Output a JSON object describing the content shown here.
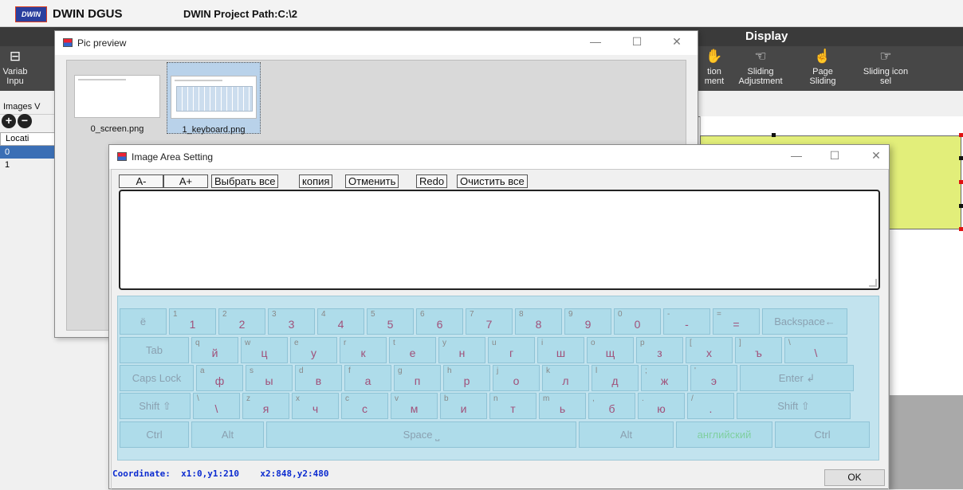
{
  "app": {
    "name": "DWIN DGUS",
    "logo_text": "DWIN",
    "path": "DWIN Project Path:C:\\2"
  },
  "ribbon": {
    "display_tab": "Display",
    "left_item": {
      "label1": "Variab",
      "label2": "Inpu"
    },
    "items": [
      {
        "label1": "tion",
        "label2": "ment"
      },
      {
        "label1": "Sliding",
        "label2": "Adjustment"
      },
      {
        "label1": "Page",
        "label2": "Sliding"
      },
      {
        "label1": "Sliding icon",
        "label2": "sel"
      }
    ]
  },
  "left_panel": {
    "tab_label": "Images V",
    "add_icon": "+",
    "remove_icon": "−",
    "column_header": "Locati",
    "rows": [
      "0",
      "1"
    ]
  },
  "pic_preview": {
    "title": "Pic preview",
    "min": "—",
    "max": "☐",
    "close": "✕",
    "thumbs": [
      {
        "caption": "0_screen.png"
      },
      {
        "caption": "1_keyboard.png"
      }
    ]
  },
  "area_setting": {
    "title": "Image Area Setting",
    "min": "—",
    "max": "☐",
    "close": "✕",
    "toolbar": {
      "a_minus": "A-",
      "a_plus": "A+",
      "select_all": "Выбрать все",
      "copy": "копия",
      "undo": "Отменить",
      "redo": "Redo",
      "clear_all": "Очистить все"
    },
    "text_value": "",
    "coordinate": "Coordinate:  x1:0,y1:210    x2:848,y2:480",
    "ok_label": "OK"
  },
  "keyboard": {
    "row1": [
      {
        "s": "",
        "p": "ё"
      },
      {
        "s": "1",
        "p": "1"
      },
      {
        "s": "2",
        "p": "2"
      },
      {
        "s": "3",
        "p": "3"
      },
      {
        "s": "4",
        "p": "4"
      },
      {
        "s": "5",
        "p": "5"
      },
      {
        "s": "6",
        "p": "6"
      },
      {
        "s": "7",
        "p": "7"
      },
      {
        "s": "8",
        "p": "8"
      },
      {
        "s": "9",
        "p": "9"
      },
      {
        "s": "0",
        "p": "0"
      },
      {
        "s": "-",
        "p": "-"
      },
      {
        "s": "=",
        "p": "="
      },
      {
        "s": "",
        "p": "Backspace←"
      }
    ],
    "row2": [
      {
        "s": "",
        "p": "Tab"
      },
      {
        "s": "q",
        "p": "й"
      },
      {
        "s": "w",
        "p": "ц"
      },
      {
        "s": "e",
        "p": "у"
      },
      {
        "s": "r",
        "p": "к"
      },
      {
        "s": "t",
        "p": "е"
      },
      {
        "s": "y",
        "p": "н"
      },
      {
        "s": "u",
        "p": "г"
      },
      {
        "s": "i",
        "p": "ш"
      },
      {
        "s": "o",
        "p": "щ"
      },
      {
        "s": "p",
        "p": "з"
      },
      {
        "s": "[",
        "p": "х"
      },
      {
        "s": "]",
        "p": "ъ"
      },
      {
        "s": "\\",
        "p": "\\"
      }
    ],
    "row3": [
      {
        "s": "",
        "p": "Caps Lock"
      },
      {
        "s": "a",
        "p": "ф"
      },
      {
        "s": "s",
        "p": "ы"
      },
      {
        "s": "d",
        "p": "в"
      },
      {
        "s": "f",
        "p": "а"
      },
      {
        "s": "g",
        "p": "п"
      },
      {
        "s": "h",
        "p": "р"
      },
      {
        "s": "j",
        "p": "о"
      },
      {
        "s": "k",
        "p": "л"
      },
      {
        "s": "l",
        "p": "д"
      },
      {
        "s": ";",
        "p": "ж"
      },
      {
        "s": "'",
        "p": "э"
      },
      {
        "s": "",
        "p": "Enter ↲"
      }
    ],
    "row4": [
      {
        "s": "",
        "p": "Shift ⇧"
      },
      {
        "s": "\\",
        "p": "\\"
      },
      {
        "s": "z",
        "p": "я"
      },
      {
        "s": "x",
        "p": "ч"
      },
      {
        "s": "c",
        "p": "с"
      },
      {
        "s": "v",
        "p": "м"
      },
      {
        "s": "b",
        "p": "и"
      },
      {
        "s": "n",
        "p": "т"
      },
      {
        "s": "m",
        "p": "ь"
      },
      {
        "s": ",",
        "p": "б"
      },
      {
        "s": ".",
        "p": "ю"
      },
      {
        "s": "/",
        "p": "."
      },
      {
        "s": "",
        "p": "Shift ⇧"
      }
    ],
    "row5": [
      {
        "s": "",
        "p": "Ctrl"
      },
      {
        "s": "",
        "p": "Alt"
      },
      {
        "s": "",
        "p": "Space ⎵"
      },
      {
        "s": "",
        "p": "Alt"
      },
      {
        "s": "",
        "p": "английский"
      },
      {
        "s": "",
        "p": "Ctrl"
      }
    ]
  }
}
